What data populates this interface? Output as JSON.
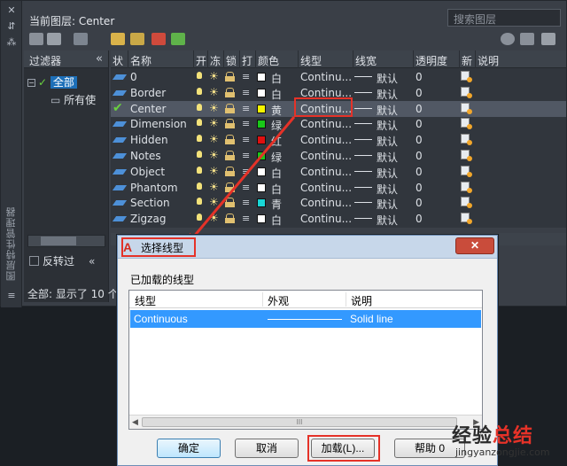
{
  "palette": {
    "current_layer": "当前图层: Center",
    "search_placeholder": "搜索图层",
    "vertical_title": "图层特性管理器",
    "status": "全部: 显示了 10 个"
  },
  "filters": {
    "title": "过滤器",
    "collapse": "«",
    "all": "全部",
    "all_used": "所有使",
    "invert": "反转过",
    "expander": "−"
  },
  "layer_table": {
    "headers": [
      "状",
      "名称",
      "开",
      "冻",
      "锁",
      "打",
      "颜色",
      "线型",
      "线宽",
      "透明度",
      "新",
      "说明"
    ],
    "rows": [
      {
        "name": "0",
        "color_name": "白",
        "color": "#ffffff",
        "linetype": "Continu...",
        "lineweight": "默认",
        "transparency": "0",
        "current": false
      },
      {
        "name": "Border",
        "color_name": "白",
        "color": "#ffffff",
        "linetype": "Continu...",
        "lineweight": "默认",
        "transparency": "0",
        "current": false
      },
      {
        "name": "Center",
        "color_name": "黄",
        "color": "#f5f500",
        "linetype": "Continu...",
        "lineweight": "默认",
        "transparency": "0",
        "current": true
      },
      {
        "name": "Dimension",
        "color_name": "绿",
        "color": "#19c819",
        "linetype": "Continu...",
        "lineweight": "默认",
        "transparency": "0",
        "current": false
      },
      {
        "name": "Hidden",
        "color_name": "红",
        "color": "#e01010",
        "linetype": "Continu...",
        "lineweight": "默认",
        "transparency": "0",
        "current": false
      },
      {
        "name": "Notes",
        "color_name": "绿",
        "color": "#19c819",
        "linetype": "Continu...",
        "lineweight": "默认",
        "transparency": "0",
        "current": false
      },
      {
        "name": "Object",
        "color_name": "白",
        "color": "#ffffff",
        "linetype": "Continu...",
        "lineweight": "默认",
        "transparency": "0",
        "current": false
      },
      {
        "name": "Phantom",
        "color_name": "白",
        "color": "#ffffff",
        "linetype": "Continu...",
        "lineweight": "默认",
        "transparency": "0",
        "current": false
      },
      {
        "name": "Section",
        "color_name": "青",
        "color": "#19d6d6",
        "linetype": "Continu...",
        "lineweight": "默认",
        "transparency": "0",
        "current": false
      },
      {
        "name": "Zigzag",
        "color_name": "白",
        "color": "#ffffff",
        "linetype": "Continu...",
        "lineweight": "默认",
        "transparency": "0",
        "current": false
      }
    ]
  },
  "dialog": {
    "title": "选择线型",
    "app_logo": "A",
    "close": "✕",
    "loaded_label": "已加载的线型",
    "columns": [
      "线型",
      "外观",
      "说明"
    ],
    "row": {
      "linetype": "Continuous",
      "description": "Solid line"
    },
    "scroll_thumb": "III",
    "buttons": {
      "ok": "确定",
      "cancel": "取消",
      "load": "加载(L)...",
      "help": "帮助 0"
    }
  },
  "watermark": {
    "title_a": "经验",
    "title_b": "总结",
    "url": "jingyanzongjie.com"
  }
}
